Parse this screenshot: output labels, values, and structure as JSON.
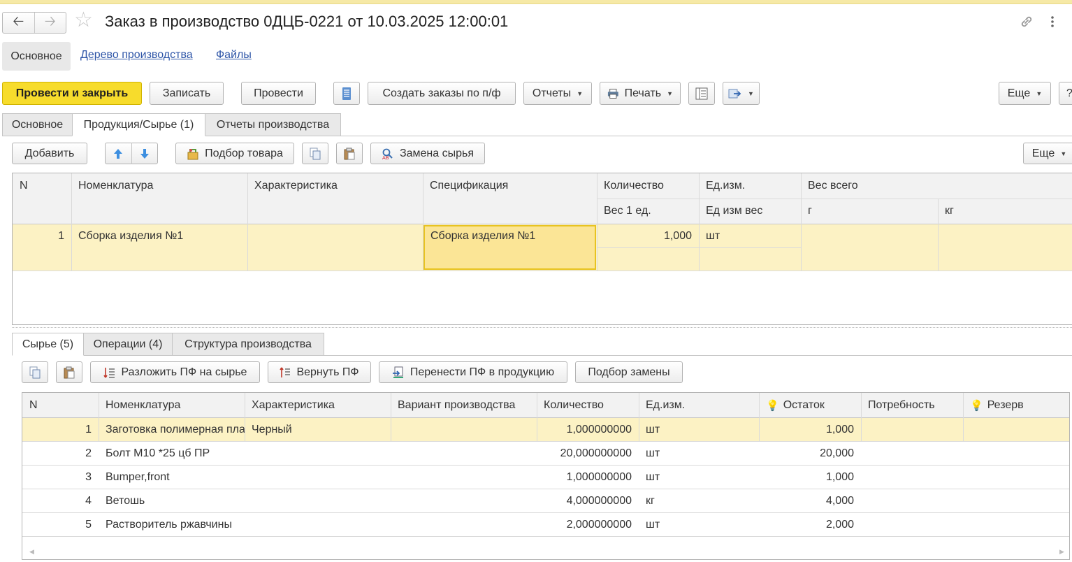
{
  "window": {
    "title": "Заказ в производство 0ДЦБ-0221 от 10.03.2025 12:00:01",
    "back_icon": "arrow-left-icon",
    "forward_icon": "arrow-right-icon",
    "star_icon": "star-icon"
  },
  "sections": {
    "active": "Основное",
    "links": [
      "Дерево производства",
      "Файлы"
    ]
  },
  "toolbar": {
    "post_close": "Провести и закрыть",
    "save": "Записать",
    "post": "Провести",
    "create_orders": "Создать заказы по п/ф",
    "reports": "Отчеты",
    "print": "Печать",
    "more": "Еще",
    "help": "?"
  },
  "tabs": {
    "items": [
      "Основное",
      "Продукция/Сырье (1)",
      "Отчеты производства"
    ],
    "active_index": 1
  },
  "products": {
    "toolbar": {
      "add": "Добавить",
      "select_goods": "Подбор товара",
      "replace_raw": "Замена сырья",
      "more": "Еще"
    },
    "headers": {
      "n": "N",
      "nomenclature": "Номенклатура",
      "characteristic": "Характеристика",
      "specification": "Спецификация",
      "quantity": "Количество",
      "unit": "Ед.изм.",
      "weight_total": "Вес всего",
      "weight_one": "Вес 1 ед.",
      "unit_weight": "Ед изм вес",
      "g": "г",
      "kg": "кг"
    },
    "rows": [
      {
        "n": "1",
        "nomenclature": "Сборка изделия №1",
        "characteristic": "",
        "specification": "Сборка изделия №1",
        "quantity": "1,000",
        "unit": "шт"
      }
    ]
  },
  "subtabs": {
    "items": [
      "Сырье (5)",
      "Операции (4)",
      "Структура производства"
    ],
    "active_index": 0
  },
  "raw": {
    "toolbar": {
      "decompose": "Разложить ПФ на сырье",
      "return": "Вернуть ПФ",
      "move": "Перенести ПФ в продукцию",
      "select_replace": "Подбор замены"
    },
    "headers": {
      "n": "N",
      "nomenclature": "Номенклатура",
      "characteristic": "Характеристика",
      "variant": "Вариант производства",
      "quantity": "Количество",
      "unit": "Ед.изм.",
      "balance": "Остаток",
      "need": "Потребность",
      "reserve": "Резерв"
    },
    "rows": [
      {
        "n": "1",
        "nomenclature": "Заготовка полимерная пластиковая",
        "characteristic": "Черный",
        "variant": "",
        "quantity": "1,000000000",
        "unit": "шт",
        "balance": "1,000",
        "need": "",
        "reserve": ""
      },
      {
        "n": "2",
        "nomenclature": "Болт  М10 *25 цб ПР",
        "characteristic": "",
        "variant": "",
        "quantity": "20,000000000",
        "unit": "шт",
        "balance": "20,000",
        "need": "",
        "reserve": ""
      },
      {
        "n": "3",
        "nomenclature": "Bumper,front",
        "characteristic": "",
        "variant": "",
        "quantity": "1,000000000",
        "unit": "шт",
        "balance": "1,000",
        "need": "",
        "reserve": ""
      },
      {
        "n": "4",
        "nomenclature": "Ветошь",
        "characteristic": "",
        "variant": "",
        "quantity": "4,000000000",
        "unit": "кг",
        "balance": "4,000",
        "need": "",
        "reserve": ""
      },
      {
        "n": "5",
        "nomenclature": "Растворитель ржавчины",
        "characteristic": "",
        "variant": "",
        "quantity": "2,000000000",
        "unit": "шт",
        "balance": "2,000",
        "need": "",
        "reserve": ""
      }
    ]
  },
  "colors": {
    "accent_yellow": "#f7dc2c",
    "row_highlight": "#fcf2c4",
    "link_blue": "#2f56a8"
  }
}
